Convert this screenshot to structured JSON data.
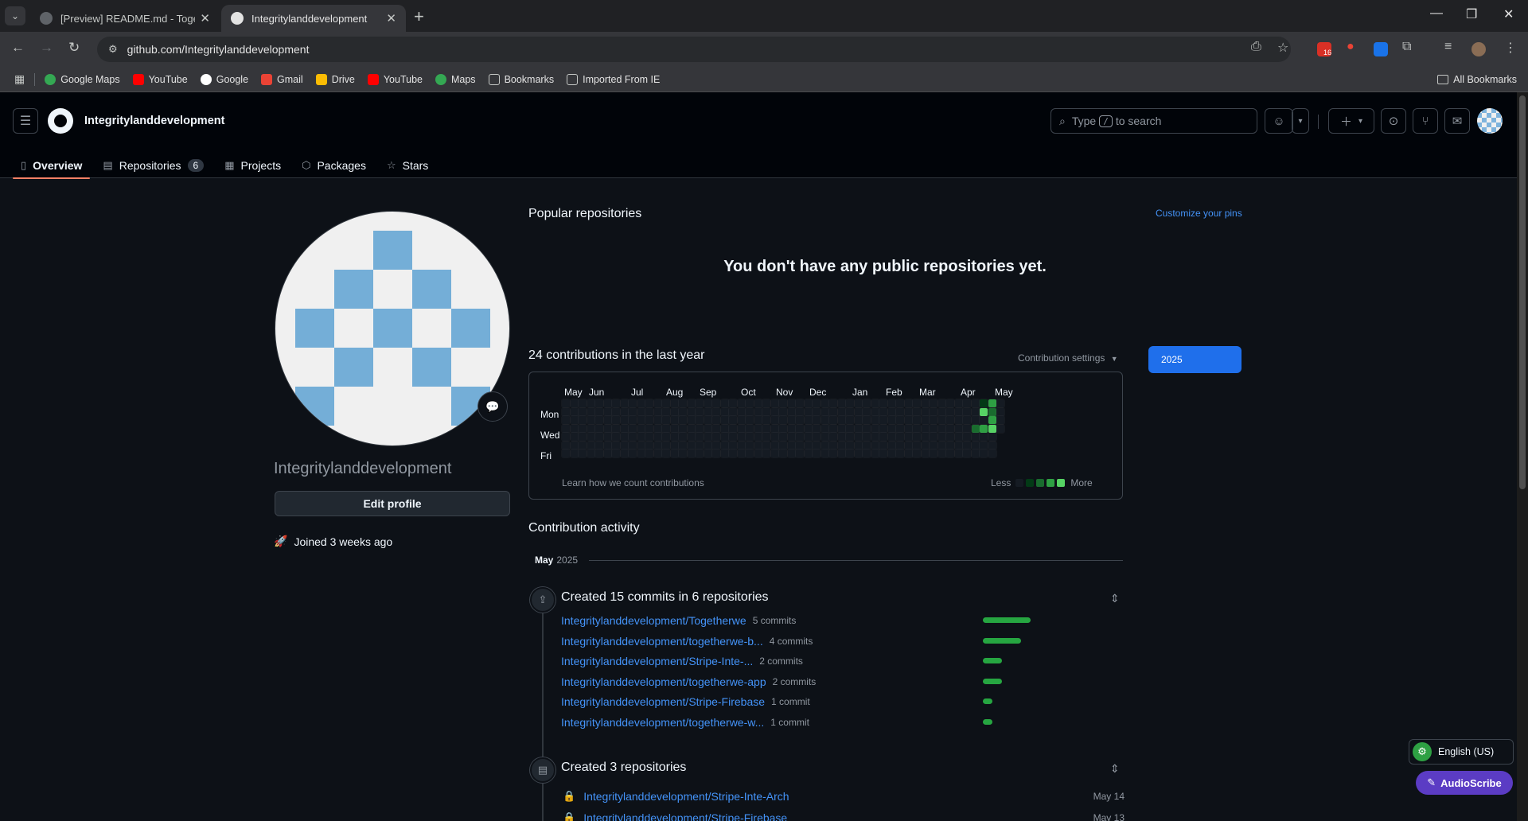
{
  "browser": {
    "tabs": [
      {
        "title": "[Preview] README.md - Togeth",
        "active": false
      },
      {
        "title": "Integritylanddevelopment",
        "active": true
      }
    ],
    "url": "github.com/Integritylanddevelopment",
    "extension_badge": "16",
    "bookmarks": [
      "Google Maps",
      "YouTube",
      "Google",
      "Gmail",
      "Drive",
      "YouTube",
      "Maps",
      "Bookmarks",
      "Imported From IE"
    ],
    "all_bookmarks": "All Bookmarks"
  },
  "github": {
    "username": "Integritylanddevelopment",
    "search_prefix": "Type",
    "search_key": "/",
    "search_suffix": "to search",
    "nav": [
      {
        "label": "Overview",
        "icon": "book-icon",
        "selected": true
      },
      {
        "label": "Repositories",
        "icon": "repo-icon",
        "count": "6"
      },
      {
        "label": "Projects",
        "icon": "table-icon"
      },
      {
        "label": "Packages",
        "icon": "package-icon"
      },
      {
        "label": "Stars",
        "icon": "star-icon"
      }
    ]
  },
  "profile": {
    "name": "Integritylanddevelopment",
    "edit_label": "Edit profile",
    "joined": "Joined 3 weeks ago"
  },
  "popular": {
    "title": "Popular repositories",
    "customize": "Customize your pins",
    "empty": "You don't have any public repositories yet."
  },
  "contributions": {
    "title": "24 contributions in the last year",
    "settings": "Contribution settings",
    "year": "2025",
    "months": [
      "May",
      "Jun",
      "Jul",
      "Aug",
      "Sep",
      "Oct",
      "Nov",
      "Dec",
      "Jan",
      "Feb",
      "Mar",
      "Apr",
      "May"
    ],
    "days": [
      "Mon",
      "Wed",
      "Fri"
    ],
    "learn": "Learn how we count contributions",
    "less": "Less",
    "more": "More",
    "level_colors": [
      "#151b23",
      "#033a16",
      "#196c2e",
      "#2ea043",
      "#56d364"
    ]
  },
  "activity": {
    "title": "Contribution activity",
    "month": "May",
    "year": "2025",
    "commits_header": "Created 15 commits in 6 repositories",
    "commits": [
      {
        "repo": "Integritylanddevelopment/Togetherwe",
        "count": "5 commits",
        "n": 5
      },
      {
        "repo": "Integritylanddevelopment/togetherwe-b...",
        "count": "4 commits",
        "n": 4
      },
      {
        "repo": "Integritylanddevelopment/Stripe-Inte-...",
        "count": "2 commits",
        "n": 2
      },
      {
        "repo": "Integritylanddevelopment/togetherwe-app",
        "count": "2 commits",
        "n": 2
      },
      {
        "repo": "Integritylanddevelopment/Stripe-Firebase",
        "count": "1 commit",
        "n": 1
      },
      {
        "repo": "Integritylanddevelopment/togetherwe-w...",
        "count": "1 commit",
        "n": 1
      }
    ],
    "repos_header": "Created 3 repositories",
    "created": [
      {
        "repo": "Integritylanddevelopment/Stripe-Inte-Arch",
        "date": "May 14"
      },
      {
        "repo": "Integritylanddevelopment/Stripe-Firebase",
        "date": "May 13"
      }
    ]
  },
  "widgets": {
    "language": "English (US)",
    "audioscribe": "AudioScribe"
  }
}
